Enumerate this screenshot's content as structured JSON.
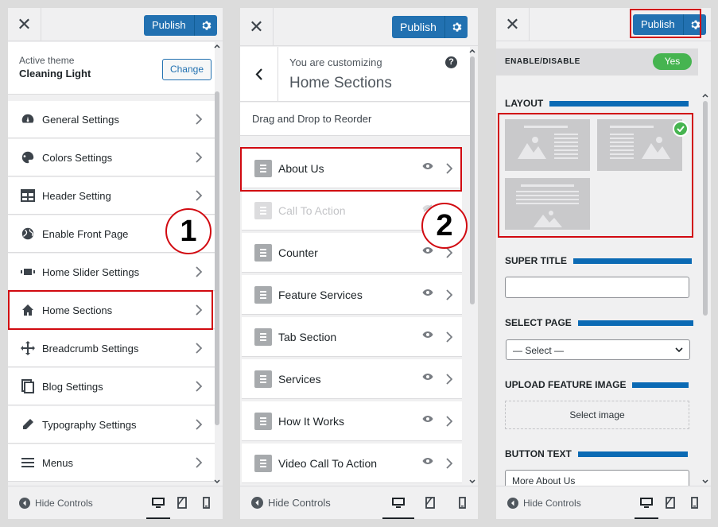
{
  "common": {
    "close_icon": "close-icon",
    "publish_label": "Publish",
    "hide_controls": "Hide Controls"
  },
  "panel1": {
    "active_theme_label": "Active theme",
    "theme_name": "Cleaning Light",
    "change_label": "Change",
    "callout": "1",
    "items": [
      {
        "label": "General Settings",
        "icon": "gauge-icon"
      },
      {
        "label": "Colors Settings",
        "icon": "palette-icon"
      },
      {
        "label": "Header Setting",
        "icon": "grid-icon"
      },
      {
        "label": "Enable Front Page",
        "icon": "globe-icon"
      },
      {
        "label": "Home Slider Settings",
        "icon": "slider-icon"
      },
      {
        "label": "Home Sections",
        "icon": "home-icon"
      },
      {
        "label": "Breadcrumb Settings",
        "icon": "move-icon"
      },
      {
        "label": "Blog Settings",
        "icon": "document-icon"
      },
      {
        "label": "Typography Settings",
        "icon": "pencil-icon"
      },
      {
        "label": "Menus",
        "icon": "menu-icon"
      }
    ]
  },
  "panel2": {
    "customizing_label": "You are customizing",
    "section_title": "Home Sections",
    "drag_hint": "Drag and Drop to Reorder",
    "callout": "2",
    "items": [
      {
        "label": "About Us",
        "visible": true
      },
      {
        "label": "Call To Action",
        "visible": false
      },
      {
        "label": "Counter",
        "visible": true
      },
      {
        "label": "Feature Services",
        "visible": true
      },
      {
        "label": "Tab Section",
        "visible": true
      },
      {
        "label": "Services",
        "visible": true
      },
      {
        "label": "How It Works",
        "visible": true
      },
      {
        "label": "Video Call To Action",
        "visible": true
      }
    ]
  },
  "panel3": {
    "enable_label": "ENABLE/DISABLE",
    "toggle_label": "Yes",
    "layout_title": "LAYOUT",
    "super_title_label": "SUPER TITLE",
    "super_title_value": "",
    "select_page_label": "SELECT PAGE",
    "select_page_value": "— Select —",
    "upload_label": "UPLOAD FEATURE IMAGE",
    "select_image_label": "Select image",
    "button_text_label": "BUTTON TEXT",
    "button_text_value": "More About Us"
  },
  "colors": {
    "accent": "#2271b1",
    "highlight": "#d10a11",
    "toggle_green": "#46b450",
    "section_bar": "#0b6ab4"
  }
}
